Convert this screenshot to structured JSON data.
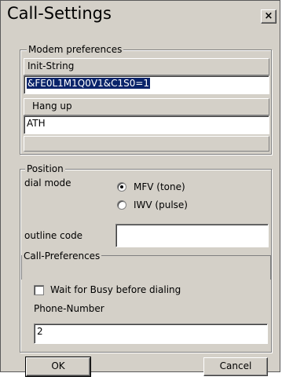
{
  "window": {
    "title": "Call-Settings",
    "close_glyph": "×"
  },
  "modem": {
    "group_label": "Modem preferences",
    "init_label": "Init-String",
    "init_value": "&FE0L1M1Q0V1&C1S0=1",
    "hangup_label": "Hang up",
    "hangup_value": "ATH"
  },
  "position": {
    "group_label": "Position",
    "dial_mode_label": "dial mode",
    "options": [
      "MFV (tone)",
      "IWV (pulse)"
    ],
    "selected_option": "MFV (tone)",
    "outline_label": "outline code",
    "outline_value": ""
  },
  "call_prefs": {
    "group_label": "Call-Preferences",
    "wait_busy_label": "Wait for Busy before dialing",
    "wait_busy_checked": false,
    "phone_label": "Phone-Number",
    "phone_value": "2"
  },
  "buttons": {
    "ok": "OK",
    "cancel": "Cancel"
  },
  "colors": {
    "face": "#d4d0c8",
    "selection": "#0a246a"
  }
}
